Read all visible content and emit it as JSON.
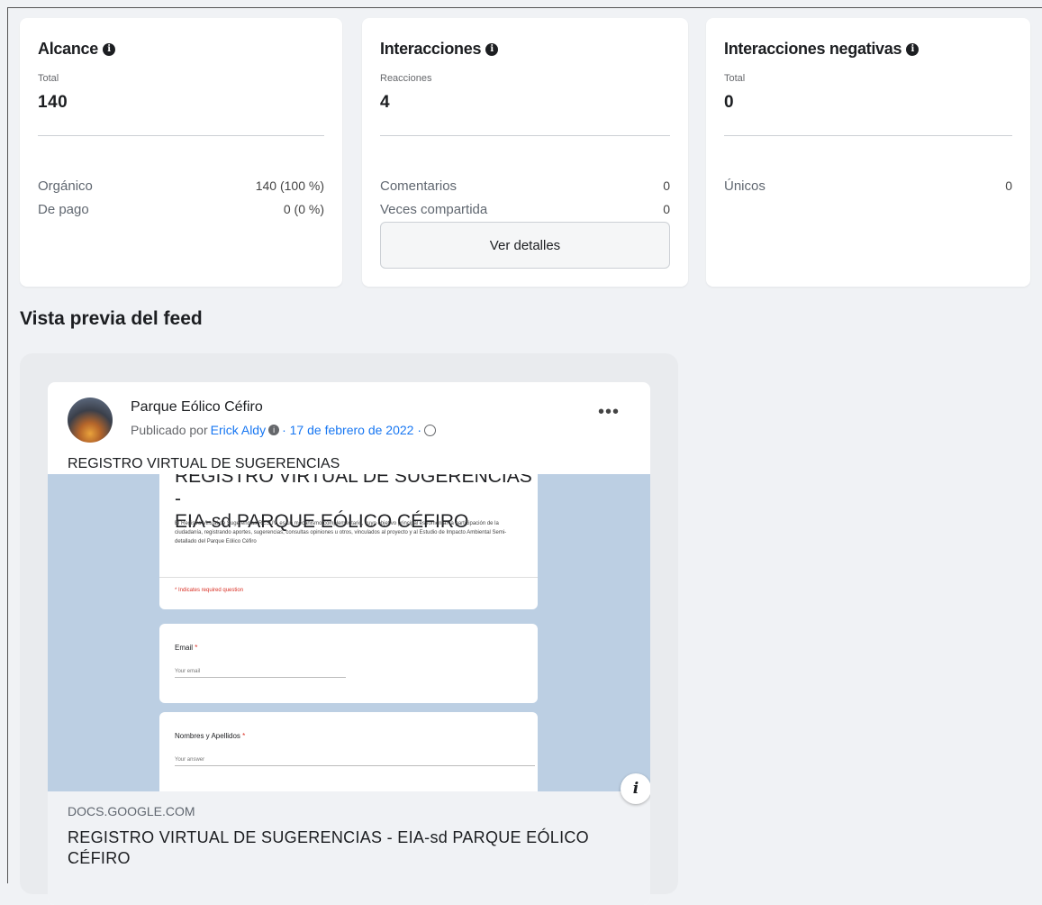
{
  "cards": [
    {
      "title": "Alcance",
      "sub_label": "Total",
      "big_value": "140",
      "rows": [
        {
          "label": "Orgánico",
          "value": "140 (100 %)"
        },
        {
          "label": "De pago",
          "value": "0 (0 %)"
        }
      ]
    },
    {
      "title": "Interacciones",
      "sub_label": "Reacciones",
      "big_value": "4",
      "rows": [
        {
          "label": "Comentarios",
          "value": "0"
        },
        {
          "label": "Veces compartida",
          "value": "0"
        }
      ],
      "button": "Ver detalles"
    },
    {
      "title": "Interacciones negativas",
      "sub_label": "Total",
      "big_value": "0",
      "rows": [
        {
          "label": "Únicos",
          "value": "0"
        }
      ]
    }
  ],
  "section_title": "Vista previa del feed",
  "post": {
    "page_name": "Parque Eólico Céfiro",
    "published_by": "Publicado por",
    "author": "Erick Aldy",
    "date": "· 17 de febrero de 2022 ·",
    "text": "REGISTRO VIRTUAL DE SUGERENCIAS",
    "more": "•••",
    "preview": {
      "form_title_line1": "REGISTRO VIRTUAL DE SUGERENCIAS -",
      "form_title_line2": "EIA-sd PARQUE EÓLICO CÉFIRO",
      "form_description": "El Registro Virtual de Sugerencias RESUV, es un mecanismo complementario, cuyo objetivo principal es fomentar la participación de la ciudadanía, registrando aportes, sugerencias, consultas opiniones u otros, vinculados al proyecto y al Estudio de Impacto Ambiental Semi-detallado del Parque Eólico Céfiro",
      "required_note": "* Indicates required question",
      "q1_label": "Email",
      "q1_placeholder": "Your email",
      "q2_label": "Nombres y Apellidos",
      "q2_placeholder": "Your answer",
      "required_star": "*"
    },
    "info_glyph": "i",
    "link_domain": "DOCS.GOOGLE.COM",
    "link_title": "REGISTRO VIRTUAL DE SUGERENCIAS - EIA-sd PARQUE EÓLICO CÉFIRO"
  }
}
